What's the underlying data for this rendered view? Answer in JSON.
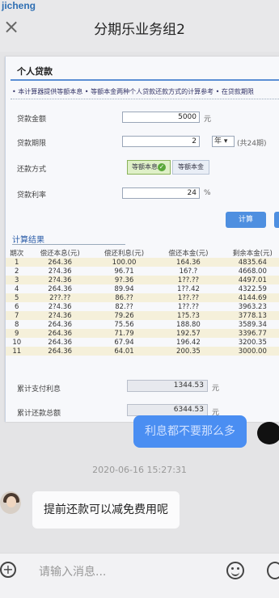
{
  "watermark": "jicheng",
  "header": {
    "title": "分期乐业务组2",
    "close_icon": "×"
  },
  "screenshot": {
    "panel_title": "个人贷款",
    "note": "• 本计算器提供等额本息 • 等额本金两种个人贷款还款方式的计算参考 • 在贷款期限",
    "form": {
      "amount_label": "贷款金额",
      "amount_value": "5000",
      "amount_unit": "元",
      "term_label": "贷款期限",
      "term_value": "2",
      "term_unit_selected": "年",
      "term_hint": "(共24期)",
      "method_label": "还款方式",
      "method_opt1": "等额本息",
      "method_opt2": "等额本金",
      "rate_label": "贷款利率",
      "rate_value": "24",
      "rate_unit": "%"
    },
    "calc_button": "计算",
    "results_title": "计算结果",
    "table": {
      "headers": [
        "期次",
        "偿还本息(元)",
        "偿还利息(元)",
        "偿还本金(元)",
        "剩余本金(元)"
      ],
      "rows": [
        [
          "1",
          "264.36",
          "100.00",
          "164.36",
          "4835.64"
        ],
        [
          "2",
          "2?4.36",
          "96.71",
          "16?.?",
          "4668.00"
        ],
        [
          "3",
          "2?4.36",
          "9?.36",
          "1??.??",
          "4497.01"
        ],
        [
          "4",
          "264.36",
          "89.94",
          "1??.42",
          "4322.59"
        ],
        [
          "5",
          "2??.??",
          "86.??",
          "1??.??",
          "4144.69"
        ],
        [
          "6",
          "2?4.36",
          "82.??",
          "1??.??",
          "3963.23"
        ],
        [
          "7",
          "2?4.36",
          "79.26",
          "1?5.?3",
          "3778.13"
        ],
        [
          "8",
          "264.36",
          "75.56",
          "188.80",
          "3589.34"
        ],
        [
          "9",
          "264.36",
          "71.79",
          "192.57",
          "3396.77"
        ],
        [
          "10",
          "264.36",
          "67.94",
          "196.42",
          "3200.35"
        ],
        [
          "11",
          "264.36",
          "64.01",
          "200.35",
          "3000.00"
        ]
      ]
    },
    "sum_interest_label": "累计支付利息",
    "sum_interest_value": "1344.53",
    "sum_interest_unit": "元",
    "sum_total_label": "累计还款总额",
    "sum_total_value": "6344.53",
    "sum_total_unit": "元"
  },
  "chat": {
    "right_message": "利息都不要那么多",
    "timestamp": "2020-06-16 15:27:31",
    "left_message": "提前还款可以减免费用呢"
  },
  "input_bar": {
    "placeholder": "请输入消息..."
  }
}
